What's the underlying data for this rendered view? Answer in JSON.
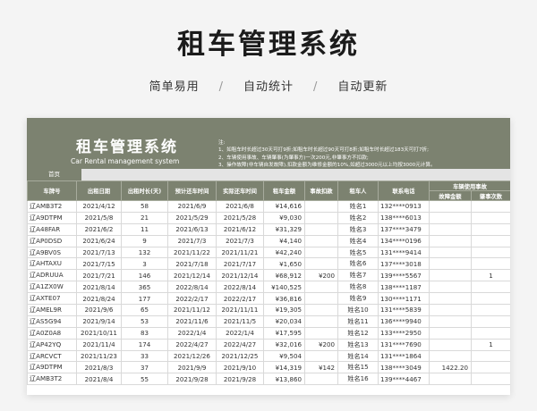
{
  "hero": {
    "title": "租车管理系统",
    "features": [
      "简单易用",
      "自动统计",
      "自动更新"
    ],
    "separator": "/"
  },
  "sheet": {
    "title": "租车管理系统",
    "subtitle": "Car Rental management system",
    "notes": [
      "注:",
      "1、如租车时长超过30天可打9折;如租车时长超过90天可打8折;如租车时长超过183天可打7折;",
      "2、车辆使用事故、车辆肇事(为肇事方)一次200元,非肇事方不扣款;",
      "3、操作故障(非车辆自发故障),扣款金额为维修金额的10%,如超过3000元以上均按3000元计算。"
    ],
    "tab": "首页",
    "colors": {
      "accent": "#7c8270"
    }
  },
  "table": {
    "headers": [
      "车牌号",
      "出租日期",
      "出租时长(天)",
      "预计还车时间",
      "实际还车时间",
      "租车金额",
      "事故扣款",
      "租车人",
      "联系电话"
    ],
    "group_header": "车辆使用事故",
    "sub_headers": [
      "故障金额",
      "肇事次数"
    ],
    "rows": [
      [
        "辽AMB3T2",
        "2021/4/12",
        "58",
        "2021/6/9",
        "2021/6/8",
        "¥14,616",
        "",
        "姓名1",
        "132****0913",
        "",
        ""
      ],
      [
        "辽A9DTPM",
        "2021/5/8",
        "21",
        "2021/5/29",
        "2021/5/28",
        "¥9,030",
        "",
        "姓名2",
        "138****6013",
        "",
        ""
      ],
      [
        "辽A48FAR",
        "2021/6/2",
        "11",
        "2021/6/13",
        "2021/6/12",
        "¥31,329",
        "",
        "姓名3",
        "137****3479",
        "",
        ""
      ],
      [
        "辽AP0DSD",
        "2021/6/24",
        "9",
        "2021/7/3",
        "2021/7/3",
        "¥4,140",
        "",
        "姓名4",
        "134****0196",
        "",
        ""
      ],
      [
        "辽A9BV0S",
        "2021/7/13",
        "132",
        "2021/11/22",
        "2021/11/21",
        "¥42,240",
        "",
        "姓名5",
        "131****9414",
        "",
        ""
      ],
      [
        "辽AHTAXU",
        "2021/7/15",
        "3",
        "2021/7/18",
        "2021/7/17",
        "¥1,650",
        "",
        "姓名6",
        "137****3018",
        "",
        ""
      ],
      [
        "辽ADRUUA",
        "2021/7/21",
        "146",
        "2021/12/14",
        "2021/12/14",
        "¥68,912",
        "¥200",
        "姓名7",
        "139****5567",
        "",
        "1"
      ],
      [
        "辽A1ZX0W",
        "2021/8/14",
        "365",
        "2022/8/14",
        "2022/8/14",
        "¥140,525",
        "",
        "姓名8",
        "138****1187",
        "",
        ""
      ],
      [
        "辽AXTE07",
        "2021/8/24",
        "177",
        "2022/2/17",
        "2022/2/17",
        "¥36,816",
        "",
        "姓名9",
        "130****1171",
        "",
        ""
      ],
      [
        "辽AMEL9R",
        "2021/9/6",
        "65",
        "2021/11/12",
        "2021/11/11",
        "¥19,305",
        "",
        "姓名10",
        "131****5839",
        "",
        ""
      ],
      [
        "辽AS5G94",
        "2021/9/14",
        "53",
        "2021/11/6",
        "2021/11/5",
        "¥20,034",
        "",
        "姓名11",
        "136****9940",
        "",
        ""
      ],
      [
        "辽A0Z0A8",
        "2021/10/11",
        "83",
        "2022/1/4",
        "2022/1/4",
        "¥17,595",
        "",
        "姓名12",
        "133****2950",
        "",
        ""
      ],
      [
        "辽AP42YQ",
        "2021/11/4",
        "174",
        "2022/4/27",
        "2022/4/27",
        "¥32,016",
        "¥200",
        "姓名13",
        "131****7690",
        "",
        "1"
      ],
      [
        "辽ARCVCT",
        "2021/11/23",
        "33",
        "2021/12/26",
        "2021/12/25",
        "¥9,504",
        "",
        "姓名14",
        "131****1864",
        "",
        ""
      ],
      [
        "辽A9DTPM",
        "2021/8/3",
        "37",
        "2021/9/9",
        "2021/9/10",
        "¥14,319",
        "¥142",
        "姓名15",
        "138****3049",
        "1422.20",
        ""
      ],
      [
        "辽AMB3T2",
        "2021/8/4",
        "55",
        "2021/9/28",
        "2021/9/28",
        "¥13,860",
        "",
        "姓名16",
        "139****4467",
        "",
        ""
      ]
    ]
  }
}
